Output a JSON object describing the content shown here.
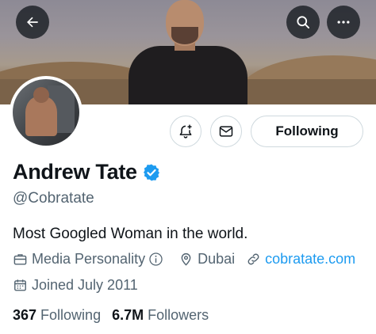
{
  "header": {
    "back_icon": "arrow-left-icon",
    "search_icon": "search-icon",
    "more_icon": "more-dots-icon"
  },
  "actions": {
    "notify_icon": "bell-plus-icon",
    "message_icon": "envelope-icon",
    "follow_label": "Following"
  },
  "profile": {
    "name": "Andrew Tate",
    "handle": "@Cobratate",
    "bio": "Most Googled Woman in the world.",
    "category": "Media Personality",
    "location": "Dubai",
    "website": "cobratate.com",
    "joined": "Joined July 2011"
  },
  "stats": {
    "following_count": "367",
    "following_label": "Following",
    "followers_count": "6.7M",
    "followers_label": "Followers"
  },
  "colors": {
    "accent": "#1d9bf0",
    "text": "#0f1419",
    "secondary": "#536471",
    "border": "#cfd9de"
  }
}
